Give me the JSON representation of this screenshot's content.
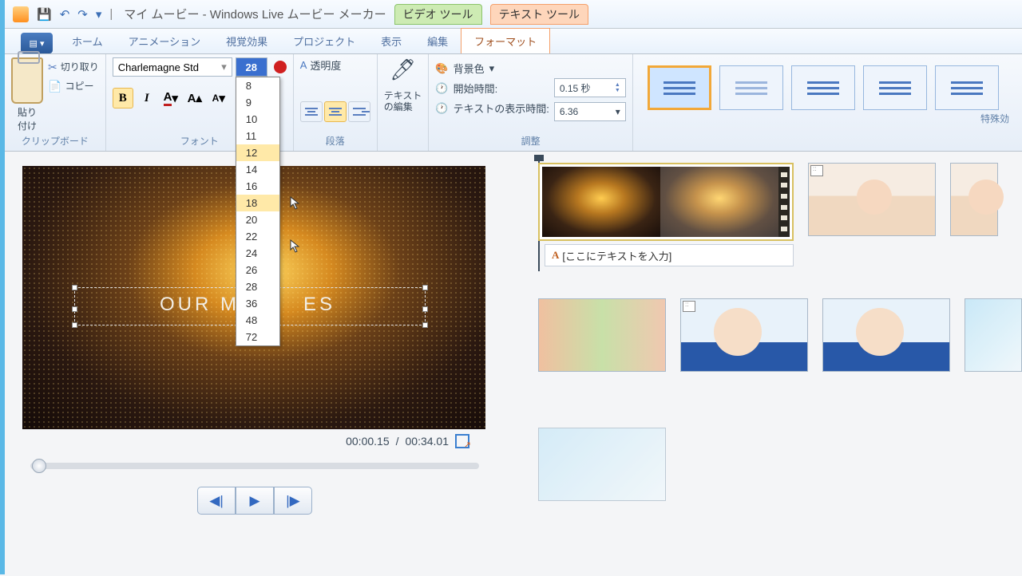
{
  "title": {
    "project": "マイ ムービー",
    "app": "Windows Live ムービー メーカー"
  },
  "context_tabs": {
    "video": "ビデオ ツール",
    "text": "テキスト ツール"
  },
  "qat": {
    "save": "💾",
    "undo": "↶",
    "redo": "↷",
    "dd": "▾"
  },
  "tabs": {
    "home": "ホーム",
    "animation": "アニメーション",
    "visual": "視覚効果",
    "project": "プロジェクト",
    "view": "表示",
    "edit": "編集",
    "format": "フォーマット"
  },
  "clipboard": {
    "paste": "貼り",
    "paste2": "付け",
    "cut": "切り取り",
    "copy": "コピー",
    "label": "クリップボード"
  },
  "font": {
    "name": "Charlemagne Std",
    "size": "28",
    "sizes": [
      "8",
      "9",
      "10",
      "11",
      "12",
      "14",
      "16",
      "18",
      "20",
      "22",
      "24",
      "26",
      "28",
      "36",
      "48",
      "72"
    ],
    "hover1": "12",
    "hover2": "18",
    "bold": "B",
    "italic": "I",
    "color": "A",
    "grow": "A",
    "shrink": "A",
    "label": "フォント"
  },
  "para": {
    "transparency": "透明度",
    "label": "段落"
  },
  "textedit": {
    "l1": "テキスト",
    "l2": "の編集"
  },
  "adjust": {
    "bgcolor": "背景色",
    "start": "開始時間:",
    "duration": "テキストの表示時間:",
    "start_val": "0.15 秒",
    "duration_val": "6.36",
    "label": "調整"
  },
  "fx": {
    "label": "特殊効"
  },
  "preview": {
    "text": "OUR M",
    "text2": "ES"
  },
  "time": {
    "current": "00:00.15",
    "total": "00:34.01"
  },
  "caption": {
    "placeholder": "[ここにテキストを入力]"
  }
}
